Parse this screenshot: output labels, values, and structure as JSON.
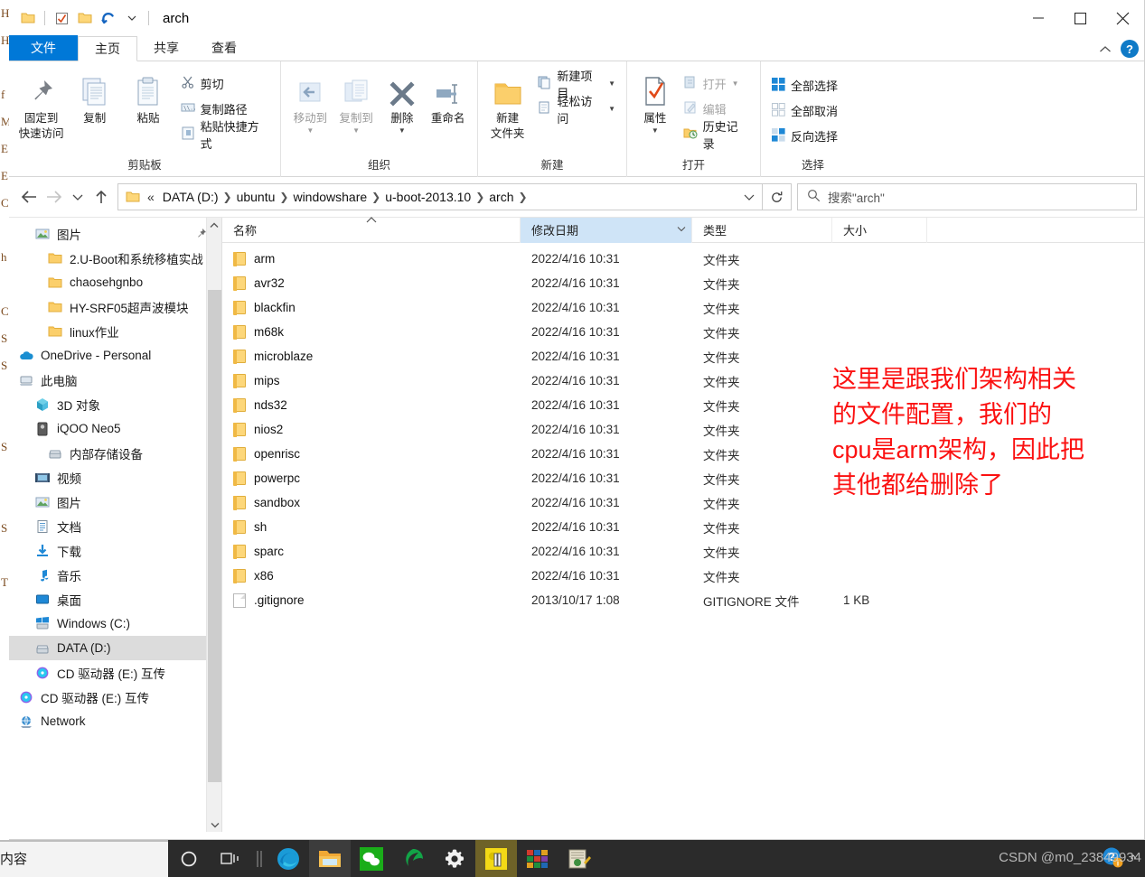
{
  "window": {
    "title": "arch",
    "quick_access_icons": [
      "folder-icon",
      "properties-check-icon",
      "new-folder-icon",
      "undo-icon",
      "customize-chevron-icon"
    ],
    "controls": {
      "minimize": "─",
      "maximize": "□",
      "close": "✕"
    }
  },
  "tabs": [
    {
      "id": "file",
      "label": "文件"
    },
    {
      "id": "home",
      "label": "主页"
    },
    {
      "id": "share",
      "label": "共享"
    },
    {
      "id": "view",
      "label": "查看"
    }
  ],
  "tab_right": {
    "collapse_icon": "chevron-up-icon",
    "help_label": "?"
  },
  "ribbon": {
    "groups": [
      {
        "id": "clipboard",
        "label": "剪贴板",
        "big": [
          {
            "label": "固定到\n快速访问",
            "line1": "固定到",
            "line2": "快速访问",
            "icon": "pin-icon"
          },
          {
            "label": "复制",
            "line1": "复制",
            "line2": "",
            "icon": "copy-icon"
          },
          {
            "label": "粘贴",
            "line1": "粘贴",
            "line2": "",
            "icon": "paste-icon"
          }
        ],
        "small": [
          {
            "label": "剪切",
            "icon": "scissors-icon",
            "dim": false
          },
          {
            "label": "复制路径",
            "icon": "copy-path-icon",
            "dim": false
          },
          {
            "label": "粘贴快捷方式",
            "icon": "paste-shortcut-icon",
            "dim": false
          }
        ]
      },
      {
        "id": "organize",
        "label": "组织",
        "big": [
          {
            "line1": "移动到",
            "line2": "",
            "icon": "move-to-icon",
            "dim": true,
            "caret": true
          },
          {
            "line1": "复制到",
            "line2": "",
            "icon": "copy-to-icon",
            "dim": true,
            "caret": true
          },
          {
            "line1": "删除",
            "line2": "",
            "icon": "delete-x-icon",
            "caret": true
          },
          {
            "line1": "重命名",
            "line2": "",
            "icon": "rename-icon"
          }
        ],
        "small": []
      },
      {
        "id": "new",
        "label": "新建",
        "big": [
          {
            "line1": "新建",
            "line2": "文件夹",
            "icon": "new-folder-icon"
          }
        ],
        "small": [
          {
            "label": "新建项目",
            "icon": "new-item-icon",
            "caret": true
          },
          {
            "label": "轻松访问",
            "icon": "easy-access-icon",
            "caret": true
          }
        ]
      },
      {
        "id": "open",
        "label": "打开",
        "big": [
          {
            "line1": "属性",
            "line2": "",
            "icon": "properties-icon",
            "caret": true
          }
        ],
        "small": [
          {
            "label": "打开",
            "icon": "open-icon",
            "dim": true,
            "caret": true
          },
          {
            "label": "编辑",
            "icon": "edit-icon",
            "dim": true
          },
          {
            "label": "历史记录",
            "icon": "history-icon"
          }
        ]
      },
      {
        "id": "select",
        "label": "选择",
        "big": [],
        "small": [
          {
            "label": "全部选择",
            "icon": "select-all-icon"
          },
          {
            "label": "全部取消",
            "icon": "select-none-icon"
          },
          {
            "label": "反向选择",
            "icon": "invert-selection-icon"
          }
        ]
      }
    ]
  },
  "addressbar": {
    "back_icon": "arrow-left-icon",
    "forward_icon": "arrow-right-icon",
    "recent_icon": "chevron-down-icon",
    "up_icon": "arrow-up-icon",
    "prefix": "«",
    "crumbs": [
      "DATA (D:)",
      "ubuntu",
      "windowshare",
      "u-boot-2013.10",
      "arch"
    ],
    "dropdown_icon": "chevron-down-icon",
    "refresh_icon": "refresh-icon",
    "search_placeholder": "搜索\"arch\"",
    "search_value": ""
  },
  "navpane": {
    "items": [
      {
        "label": "图片",
        "icon": "pictures-icon",
        "indent": "root",
        "pinned": true
      },
      {
        "label": "2.U-Boot和系统移植实战",
        "icon": "folder-icon",
        "indent": "sub"
      },
      {
        "label": "chaosehgnbo",
        "icon": "folder-icon",
        "indent": "sub"
      },
      {
        "label": "HY-SRF05超声波模块",
        "icon": "folder-icon",
        "indent": "sub"
      },
      {
        "label": "linux作业",
        "icon": "folder-icon",
        "indent": "sub"
      },
      {
        "label": "OneDrive - Personal",
        "icon": "onedrive-icon",
        "indent": "top"
      },
      {
        "label": "此电脑",
        "icon": "this-pc-icon",
        "indent": "top"
      },
      {
        "label": "3D 对象",
        "icon": "3d-objects-icon",
        "indent": "root"
      },
      {
        "label": "iQOO Neo5",
        "icon": "phone-icon",
        "indent": "root"
      },
      {
        "label": "内部存储设备",
        "icon": "drive-icon",
        "indent": "sub"
      },
      {
        "label": "视频",
        "icon": "videos-icon",
        "indent": "root"
      },
      {
        "label": "图片",
        "icon": "pictures-icon",
        "indent": "root"
      },
      {
        "label": "文档",
        "icon": "documents-icon",
        "indent": "root"
      },
      {
        "label": "下载",
        "icon": "downloads-icon",
        "indent": "root"
      },
      {
        "label": "音乐",
        "icon": "music-icon",
        "indent": "root"
      },
      {
        "label": "桌面",
        "icon": "desktop-icon",
        "indent": "root"
      },
      {
        "label": "Windows (C:)",
        "icon": "windows-drive-icon",
        "indent": "root"
      },
      {
        "label": "DATA (D:)",
        "icon": "drive-icon",
        "indent": "root",
        "selected": true
      },
      {
        "label": "CD 驱动器 (E:) 互传",
        "icon": "cd-drive-icon",
        "indent": "root"
      },
      {
        "label": "CD 驱动器 (E:) 互传",
        "icon": "cd-drive-icon",
        "indent": "top"
      },
      {
        "label": "Network",
        "icon": "network-icon",
        "indent": "top"
      }
    ]
  },
  "filelist": {
    "columns": [
      {
        "key": "name",
        "label": "名称",
        "sorted": true
      },
      {
        "key": "date",
        "label": "修改日期",
        "highlight": true
      },
      {
        "key": "type",
        "label": "类型"
      },
      {
        "key": "size",
        "label": "大小"
      }
    ],
    "rows": [
      {
        "name": "arm",
        "date": "2022/4/16 10:31",
        "type": "文件夹",
        "size": "",
        "icon": "folder-icon"
      },
      {
        "name": "avr32",
        "date": "2022/4/16 10:31",
        "type": "文件夹",
        "size": "",
        "icon": "folder-icon"
      },
      {
        "name": "blackfin",
        "date": "2022/4/16 10:31",
        "type": "文件夹",
        "size": "",
        "icon": "folder-icon"
      },
      {
        "name": "m68k",
        "date": "2022/4/16 10:31",
        "type": "文件夹",
        "size": "",
        "icon": "folder-icon"
      },
      {
        "name": "microblaze",
        "date": "2022/4/16 10:31",
        "type": "文件夹",
        "size": "",
        "icon": "folder-icon"
      },
      {
        "name": "mips",
        "date": "2022/4/16 10:31",
        "type": "文件夹",
        "size": "",
        "icon": "folder-icon"
      },
      {
        "name": "nds32",
        "date": "2022/4/16 10:31",
        "type": "文件夹",
        "size": "",
        "icon": "folder-icon"
      },
      {
        "name": "nios2",
        "date": "2022/4/16 10:31",
        "type": "文件夹",
        "size": "",
        "icon": "folder-icon"
      },
      {
        "name": "openrisc",
        "date": "2022/4/16 10:31",
        "type": "文件夹",
        "size": "",
        "icon": "folder-icon"
      },
      {
        "name": "powerpc",
        "date": "2022/4/16 10:31",
        "type": "文件夹",
        "size": "",
        "icon": "folder-icon"
      },
      {
        "name": "sandbox",
        "date": "2022/4/16 10:31",
        "type": "文件夹",
        "size": "",
        "icon": "folder-icon"
      },
      {
        "name": "sh",
        "date": "2022/4/16 10:31",
        "type": "文件夹",
        "size": "",
        "icon": "folder-icon"
      },
      {
        "name": "sparc",
        "date": "2022/4/16 10:31",
        "type": "文件夹",
        "size": "",
        "icon": "folder-icon"
      },
      {
        "name": "x86",
        "date": "2022/4/16 10:31",
        "type": "文件夹",
        "size": "",
        "icon": "folder-icon"
      },
      {
        "name": ".gitignore",
        "date": "2013/10/17 1:08",
        "type": "GITIGNORE 文件",
        "size": "1 KB",
        "icon": "file-icon"
      }
    ]
  },
  "annotation": {
    "lines": [
      "这里是跟我们架构相关",
      "的文件配置，我们的",
      "cpu是arm架构，因此把",
      "其他都给删除了"
    ],
    "color": "#fb1111"
  },
  "background_window": {
    "left_strip": "H\nH\n\nf\nM\nE\nE\nC\n\nh\n\nC\nS\nS\n\n\nS\n\n\nS\n\nT",
    "bottom_text": "内容"
  },
  "taskbar": {
    "items": [
      {
        "id": "cortana",
        "icon": "circle-icon",
        "state": ""
      },
      {
        "id": "task-view",
        "icon": "task-view-icon",
        "state": ""
      },
      {
        "id": "divider",
        "icon": "divider-icon",
        "state": ""
      },
      {
        "id": "edge",
        "icon": "edge-icon",
        "state": ""
      },
      {
        "id": "file-explorer",
        "icon": "folder-icon",
        "state": "active"
      },
      {
        "id": "wechat",
        "icon": "wechat-icon",
        "state": ""
      },
      {
        "id": "qq-green",
        "icon": "green-swirl-icon",
        "state": ""
      },
      {
        "id": "settings",
        "icon": "gear-icon",
        "state": ""
      },
      {
        "id": "putty",
        "icon": "putty-icon",
        "state": "hl"
      },
      {
        "id": "winrar",
        "icon": "winrar-icon",
        "state": ""
      },
      {
        "id": "notepad-plus",
        "icon": "notepad-icon",
        "state": ""
      }
    ],
    "tray": {
      "help_icon": "help-question-icon",
      "chevron": "^",
      "watermark": "CSDN @m0_23849934"
    }
  }
}
